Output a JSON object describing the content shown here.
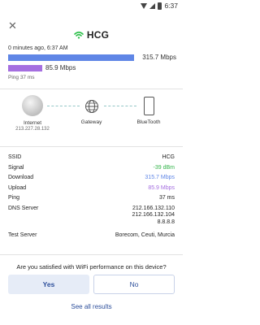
{
  "status_bar": {
    "time": "6:37"
  },
  "header": {
    "network_name": "HCG",
    "wifi_color": "#2dbf4a"
  },
  "summary": {
    "timestamp": "0 minutes ago, 6:37 AM",
    "download_value": "315.7 Mbps",
    "upload_value": "85.9 Mbps",
    "ping": "Ping 37 ms",
    "download_bar_fraction": 1.0,
    "upload_bar_fraction": 0.27,
    "download_color": "#5f86e6",
    "upload_color": "#a56fe0"
  },
  "network": {
    "internet_label": "Internet",
    "internet_ip": "213.227.28.132",
    "gateway_label": "Gateway",
    "device_label": "BlueTooth"
  },
  "details": {
    "ssid_label": "SSID",
    "ssid_value": "HCG",
    "signal_label": "Signal",
    "signal_value": "-39 dBm",
    "download_label": "Download",
    "download_value": "315.7 Mbps",
    "upload_label": "Upload",
    "upload_value": "85.9 Mbps",
    "ping_label": "Ping",
    "ping_value": "37 ms",
    "dns_label": "DNS Server",
    "dns_1": "212.166.132.110",
    "dns_2": "212.166.132.104",
    "dns_3": "8.8.8.8",
    "test_server_label": "Test Server",
    "test_server_value": "Borecom, Ceuti, Murcia",
    "signal_color": "#33b44a",
    "download_color": "#5f86e6",
    "upload_color": "#a56fe0"
  },
  "feedback": {
    "question": "Are you satisfied with WiFi performance on this device?",
    "yes_label": "Yes",
    "no_label": "No"
  },
  "footer": {
    "see_all_label": "See all results"
  }
}
